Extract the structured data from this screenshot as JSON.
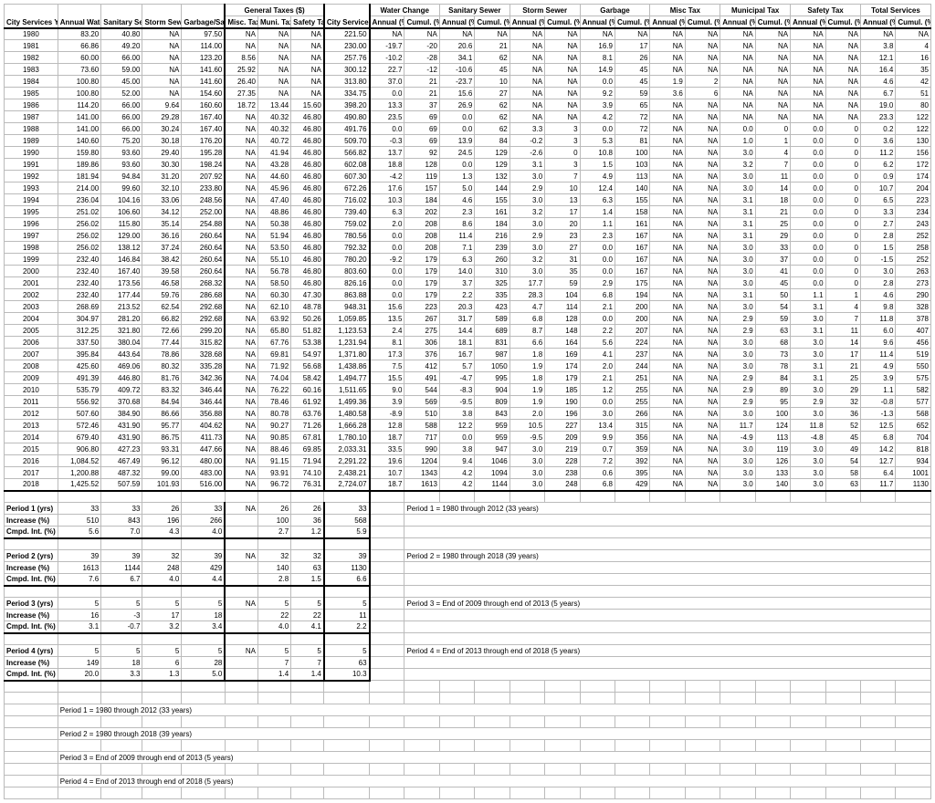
{
  "headers": {
    "top": [
      "City Services Year",
      "Annual Water Cost ($)",
      "Sanitary Sewer Cost ($)",
      "Storm Sewer Cost ($)",
      "Garbage/Sanitation Cost ($)",
      "General Taxes ($)",
      "",
      "",
      "City Services Total ($)",
      "Water Change",
      "",
      "Sanitary Sewer",
      "",
      "Storm Sewer",
      "",
      "Garbage",
      "",
      "Misc Tax",
      "",
      "Municipal Tax",
      "",
      "Safety Tax",
      "",
      "Total Services",
      ""
    ],
    "sub": [
      "",
      "",
      "",
      "",
      "",
      "Misc. Tax",
      "Muni. Tax",
      "Safety Tax",
      "",
      "Annual (%)",
      "Cumul. (%)",
      "Annual (%)",
      "Cumul. (%)",
      "Annual (%)",
      "Cumul. (%)",
      "Annual (%)",
      "Cumul. (%)",
      "Annual (%)",
      "Cumul. (%)",
      "Annual (%)",
      "Cumul. (%)",
      "Annual (%)",
      "Cumul. (%)",
      "Annual (%)",
      "Cumul. (%)"
    ]
  },
  "rows": [
    [
      "1980",
      "83.20",
      "40.80",
      "NA",
      "97.50",
      "NA",
      "NA",
      "NA",
      "221.50",
      "NA",
      "NA",
      "NA",
      "NA",
      "NA",
      "NA",
      "NA",
      "NA",
      "NA",
      "NA",
      "NA",
      "NA",
      "NA",
      "NA",
      "NA",
      "NA"
    ],
    [
      "1981",
      "66.86",
      "49.20",
      "NA",
      "114.00",
      "NA",
      "NA",
      "NA",
      "230.00",
      "-19.7",
      "-20",
      "20.6",
      "21",
      "NA",
      "NA",
      "16.9",
      "17",
      "NA",
      "NA",
      "NA",
      "NA",
      "NA",
      "NA",
      "3.8",
      "4"
    ],
    [
      "1982",
      "60.00",
      "66.00",
      "NA",
      "123.20",
      "8.56",
      "NA",
      "NA",
      "257.76",
      "-10.2",
      "-28",
      "34.1",
      "62",
      "NA",
      "NA",
      "8.1",
      "26",
      "NA",
      "NA",
      "NA",
      "NA",
      "NA",
      "NA",
      "12.1",
      "16"
    ],
    [
      "1983",
      "73.60",
      "59.00",
      "NA",
      "141.60",
      "25.92",
      "NA",
      "NA",
      "300.12",
      "22.7",
      "-12",
      "-10.6",
      "45",
      "NA",
      "NA",
      "14.9",
      "45",
      "NA",
      "NA",
      "NA",
      "NA",
      "NA",
      "NA",
      "16.4",
      "35"
    ],
    [
      "1984",
      "100.80",
      "45.00",
      "NA",
      "141.60",
      "26.40",
      "NA",
      "NA",
      "313.80",
      "37.0",
      "21",
      "-23.7",
      "10",
      "NA",
      "NA",
      "0.0",
      "45",
      "1.9",
      "2",
      "NA",
      "NA",
      "NA",
      "NA",
      "4.6",
      "42"
    ],
    [
      "1985",
      "100.80",
      "52.00",
      "NA",
      "154.60",
      "27.35",
      "NA",
      "NA",
      "334.75",
      "0.0",
      "21",
      "15.6",
      "27",
      "NA",
      "NA",
      "9.2",
      "59",
      "3.6",
      "6",
      "NA",
      "NA",
      "NA",
      "NA",
      "6.7",
      "51"
    ],
    [
      "1986",
      "114.20",
      "66.00",
      "9.64",
      "160.60",
      "18.72",
      "13.44",
      "15.60",
      "398.20",
      "13.3",
      "37",
      "26.9",
      "62",
      "NA",
      "NA",
      "3.9",
      "65",
      "NA",
      "NA",
      "NA",
      "NA",
      "NA",
      "NA",
      "19.0",
      "80"
    ],
    [
      "1987",
      "141.00",
      "66.00",
      "29.28",
      "167.40",
      "NA",
      "40.32",
      "46.80",
      "490.80",
      "23.5",
      "69",
      "0.0",
      "62",
      "NA",
      "NA",
      "4.2",
      "72",
      "NA",
      "NA",
      "NA",
      "NA",
      "NA",
      "NA",
      "23.3",
      "122"
    ],
    [
      "1988",
      "141.00",
      "66.00",
      "30.24",
      "167.40",
      "NA",
      "40.32",
      "46.80",
      "491.76",
      "0.0",
      "69",
      "0.0",
      "62",
      "3.3",
      "3",
      "0.0",
      "72",
      "NA",
      "NA",
      "0.0",
      "0",
      "0.0",
      "0",
      "0.2",
      "122"
    ],
    [
      "1989",
      "140.60",
      "75.20",
      "30.18",
      "176.20",
      "NA",
      "40.72",
      "46.80",
      "509.70",
      "-0.3",
      "69",
      "13.9",
      "84",
      "-0.2",
      "3",
      "5.3",
      "81",
      "NA",
      "NA",
      "1.0",
      "1",
      "0.0",
      "0",
      "3.6",
      "130"
    ],
    [
      "1990",
      "159.80",
      "93.60",
      "29.40",
      "195.28",
      "NA",
      "41.94",
      "46.80",
      "566.82",
      "13.7",
      "92",
      "24.5",
      "129",
      "-2.6",
      "0",
      "10.8",
      "100",
      "NA",
      "NA",
      "3.0",
      "4",
      "0.0",
      "0",
      "11.2",
      "156"
    ],
    [
      "1991",
      "189.86",
      "93.60",
      "30.30",
      "198.24",
      "NA",
      "43.28",
      "46.80",
      "602.08",
      "18.8",
      "128",
      "0.0",
      "129",
      "3.1",
      "3",
      "1.5",
      "103",
      "NA",
      "NA",
      "3.2",
      "7",
      "0.0",
      "0",
      "6.2",
      "172"
    ],
    [
      "1992",
      "181.94",
      "94.84",
      "31.20",
      "207.92",
      "NA",
      "44.60",
      "46.80",
      "607.30",
      "-4.2",
      "119",
      "1.3",
      "132",
      "3.0",
      "7",
      "4.9",
      "113",
      "NA",
      "NA",
      "3.0",
      "11",
      "0.0",
      "0",
      "0.9",
      "174"
    ],
    [
      "1993",
      "214.00",
      "99.60",
      "32.10",
      "233.80",
      "NA",
      "45.96",
      "46.80",
      "672.26",
      "17.6",
      "157",
      "5.0",
      "144",
      "2.9",
      "10",
      "12.4",
      "140",
      "NA",
      "NA",
      "3.0",
      "14",
      "0.0",
      "0",
      "10.7",
      "204"
    ],
    [
      "1994",
      "236.04",
      "104.16",
      "33.06",
      "248.56",
      "NA",
      "47.40",
      "46.80",
      "716.02",
      "10.3",
      "184",
      "4.6",
      "155",
      "3.0",
      "13",
      "6.3",
      "155",
      "NA",
      "NA",
      "3.1",
      "18",
      "0.0",
      "0",
      "6.5",
      "223"
    ],
    [
      "1995",
      "251.02",
      "106.60",
      "34.12",
      "252.00",
      "NA",
      "48.86",
      "46.80",
      "739.40",
      "6.3",
      "202",
      "2.3",
      "161",
      "3.2",
      "17",
      "1.4",
      "158",
      "NA",
      "NA",
      "3.1",
      "21",
      "0.0",
      "0",
      "3.3",
      "234"
    ],
    [
      "1996",
      "256.02",
      "115.80",
      "35.14",
      "254.88",
      "NA",
      "50.38",
      "46.80",
      "759.02",
      "2.0",
      "208",
      "8.6",
      "184",
      "3.0",
      "20",
      "1.1",
      "161",
      "NA",
      "NA",
      "3.1",
      "25",
      "0.0",
      "0",
      "2.7",
      "243"
    ],
    [
      "1997",
      "256.02",
      "129.00",
      "36.16",
      "260.64",
      "NA",
      "51.94",
      "46.80",
      "780.56",
      "0.0",
      "208",
      "11.4",
      "216",
      "2.9",
      "23",
      "2.3",
      "167",
      "NA",
      "NA",
      "3.1",
      "29",
      "0.0",
      "0",
      "2.8",
      "252"
    ],
    [
      "1998",
      "256.02",
      "138.12",
      "37.24",
      "260.64",
      "NA",
      "53.50",
      "46.80",
      "792.32",
      "0.0",
      "208",
      "7.1",
      "239",
      "3.0",
      "27",
      "0.0",
      "167",
      "NA",
      "NA",
      "3.0",
      "33",
      "0.0",
      "0",
      "1.5",
      "258"
    ],
    [
      "1999",
      "232.40",
      "146.84",
      "38.42",
      "260.64",
      "NA",
      "55.10",
      "46.80",
      "780.20",
      "-9.2",
      "179",
      "6.3",
      "260",
      "3.2",
      "31",
      "0.0",
      "167",
      "NA",
      "NA",
      "3.0",
      "37",
      "0.0",
      "0",
      "-1.5",
      "252"
    ],
    [
      "2000",
      "232.40",
      "167.40",
      "39.58",
      "260.64",
      "NA",
      "56.78",
      "46.80",
      "803.60",
      "0.0",
      "179",
      "14.0",
      "310",
      "3.0",
      "35",
      "0.0",
      "167",
      "NA",
      "NA",
      "3.0",
      "41",
      "0.0",
      "0",
      "3.0",
      "263"
    ],
    [
      "2001",
      "232.40",
      "173.56",
      "46.58",
      "268.32",
      "NA",
      "58.50",
      "46.80",
      "826.16",
      "0.0",
      "179",
      "3.7",
      "325",
      "17.7",
      "59",
      "2.9",
      "175",
      "NA",
      "NA",
      "3.0",
      "45",
      "0.0",
      "0",
      "2.8",
      "273"
    ],
    [
      "2002",
      "232.40",
      "177.44",
      "59.76",
      "286.68",
      "NA",
      "60.30",
      "47.30",
      "863.88",
      "0.0",
      "179",
      "2.2",
      "335",
      "28.3",
      "104",
      "6.8",
      "194",
      "NA",
      "NA",
      "3.1",
      "50",
      "1.1",
      "1",
      "4.6",
      "290"
    ],
    [
      "2003",
      "268.69",
      "213.52",
      "62.54",
      "292.68",
      "NA",
      "62.10",
      "48.78",
      "948.31",
      "15.6",
      "223",
      "20.3",
      "423",
      "4.7",
      "114",
      "2.1",
      "200",
      "NA",
      "NA",
      "3.0",
      "54",
      "3.1",
      "4",
      "9.8",
      "328"
    ],
    [
      "2004",
      "304.97",
      "281.20",
      "66.82",
      "292.68",
      "NA",
      "63.92",
      "50.26",
      "1,059.85",
      "13.5",
      "267",
      "31.7",
      "589",
      "6.8",
      "128",
      "0.0",
      "200",
      "NA",
      "NA",
      "2.9",
      "59",
      "3.0",
      "7",
      "11.8",
      "378"
    ],
    [
      "2005",
      "312.25",
      "321.80",
      "72.66",
      "299.20",
      "NA",
      "65.80",
      "51.82",
      "1,123.53",
      "2.4",
      "275",
      "14.4",
      "689",
      "8.7",
      "148",
      "2.2",
      "207",
      "NA",
      "NA",
      "2.9",
      "63",
      "3.1",
      "11",
      "6.0",
      "407"
    ],
    [
      "2006",
      "337.50",
      "380.04",
      "77.44",
      "315.82",
      "NA",
      "67.76",
      "53.38",
      "1,231.94",
      "8.1",
      "306",
      "18.1",
      "831",
      "6.6",
      "164",
      "5.6",
      "224",
      "NA",
      "NA",
      "3.0",
      "68",
      "3.0",
      "14",
      "9.6",
      "456"
    ],
    [
      "2007",
      "395.84",
      "443.64",
      "78.86",
      "328.68",
      "NA",
      "69.81",
      "54.97",
      "1,371.80",
      "17.3",
      "376",
      "16.7",
      "987",
      "1.8",
      "169",
      "4.1",
      "237",
      "NA",
      "NA",
      "3.0",
      "73",
      "3.0",
      "17",
      "11.4",
      "519"
    ],
    [
      "2008",
      "425.60",
      "469.06",
      "80.32",
      "335.28",
      "NA",
      "71.92",
      "56.68",
      "1,438.86",
      "7.5",
      "412",
      "5.7",
      "1050",
      "1.9",
      "174",
      "2.0",
      "244",
      "NA",
      "NA",
      "3.0",
      "78",
      "3.1",
      "21",
      "4.9",
      "550"
    ],
    [
      "2009",
      "491.39",
      "446.80",
      "81.76",
      "342.36",
      "NA",
      "74.04",
      "58.42",
      "1,494.77",
      "15.5",
      "491",
      "-4.7",
      "995",
      "1.8",
      "179",
      "2.1",
      "251",
      "NA",
      "NA",
      "2.9",
      "84",
      "3.1",
      "25",
      "3.9",
      "575"
    ],
    [
      "2010",
      "535.79",
      "409.72",
      "83.32",
      "346.44",
      "NA",
      "76.22",
      "60.16",
      "1,511.65",
      "9.0",
      "544",
      "-8.3",
      "904",
      "1.9",
      "185",
      "1.2",
      "255",
      "NA",
      "NA",
      "2.9",
      "89",
      "3.0",
      "29",
      "1.1",
      "582"
    ],
    [
      "2011",
      "556.92",
      "370.68",
      "84.94",
      "346.44",
      "NA",
      "78.46",
      "61.92",
      "1,499.36",
      "3.9",
      "569",
      "-9.5",
      "809",
      "1.9",
      "190",
      "0.0",
      "255",
      "NA",
      "NA",
      "2.9",
      "95",
      "2.9",
      "32",
      "-0.8",
      "577"
    ],
    [
      "2012",
      "507.60",
      "384.90",
      "86.66",
      "356.88",
      "NA",
      "80.78",
      "63.76",
      "1,480.58",
      "-8.9",
      "510",
      "3.8",
      "843",
      "2.0",
      "196",
      "3.0",
      "266",
      "NA",
      "NA",
      "3.0",
      "100",
      "3.0",
      "36",
      "-1.3",
      "568"
    ],
    [
      "2013",
      "572.46",
      "431.90",
      "95.77",
      "404.62",
      "NA",
      "90.27",
      "71.26",
      "1,666.28",
      "12.8",
      "588",
      "12.2",
      "959",
      "10.5",
      "227",
      "13.4",
      "315",
      "NA",
      "NA",
      "11.7",
      "124",
      "11.8",
      "52",
      "12.5",
      "652"
    ],
    [
      "2014",
      "679.40",
      "431.90",
      "86.75",
      "411.73",
      "NA",
      "90.85",
      "67.81",
      "1,780.10",
      "18.7",
      "717",
      "0.0",
      "959",
      "-9.5",
      "209",
      "9.9",
      "356",
      "NA",
      "NA",
      "-4.9",
      "113",
      "-4.8",
      "45",
      "6.8",
      "704"
    ],
    [
      "2015",
      "906.80",
      "427.23",
      "93.31",
      "447.66",
      "NA",
      "88.46",
      "69.85",
      "2,033.31",
      "33.5",
      "990",
      "3.8",
      "947",
      "3.0",
      "219",
      "0.7",
      "359",
      "NA",
      "NA",
      "3.0",
      "119",
      "3.0",
      "49",
      "14.2",
      "818"
    ],
    [
      "2016",
      "1,084.52",
      "467.49",
      "96.12",
      "480.00",
      "NA",
      "91.15",
      "71.94",
      "2,291.22",
      "19.6",
      "1204",
      "9.4",
      "1046",
      "3.0",
      "228",
      "7.2",
      "392",
      "NA",
      "NA",
      "3.0",
      "126",
      "3.0",
      "54",
      "12.7",
      "934"
    ],
    [
      "2017",
      "1,200.88",
      "487.32",
      "99.00",
      "483.00",
      "NA",
      "93.91",
      "74.10",
      "2,438.21",
      "10.7",
      "1343",
      "4.2",
      "1094",
      "3.0",
      "238",
      "0.6",
      "395",
      "NA",
      "NA",
      "3.0",
      "133",
      "3.0",
      "58",
      "6.4",
      "1001"
    ],
    [
      "2018",
      "1,425.52",
      "507.59",
      "101.93",
      "516.00",
      "NA",
      "96.72",
      "76.31",
      "2,724.07",
      "18.7",
      "1613",
      "4.2",
      "1144",
      "3.0",
      "248",
      "6.8",
      "429",
      "NA",
      "NA",
      "3.0",
      "140",
      "3.0",
      "63",
      "11.7",
      "1130"
    ]
  ],
  "periods": [
    {
      "label": "Period 1 (yrs)",
      "vals": [
        "33",
        "33",
        "26",
        "33",
        "NA",
        "26",
        "26",
        "33"
      ],
      "desc": "Period 1 = 1980 through 2012 (33 years)"
    },
    {
      "label": "Increase (%)",
      "vals": [
        "510",
        "843",
        "196",
        "266",
        "",
        "100",
        "36",
        "568"
      ],
      "desc": ""
    },
    {
      "label": "Cmpd. Int. (%)",
      "vals": [
        "5.6",
        "7.0",
        "4.3",
        "4.0",
        "",
        "2.7",
        "1.2",
        "5.9"
      ],
      "desc": ""
    },
    {
      "label": "",
      "vals": [
        "",
        "",
        "",
        "",
        "",
        "",
        "",
        ""
      ],
      "desc": ""
    },
    {
      "label": "Period 2 (yrs)",
      "vals": [
        "39",
        "39",
        "32",
        "39",
        "NA",
        "32",
        "32",
        "39"
      ],
      "desc": "Period 2 = 1980 through 2018 (39 years)"
    },
    {
      "label": "Increase (%)",
      "vals": [
        "1613",
        "1144",
        "248",
        "429",
        "",
        "140",
        "63",
        "1130"
      ],
      "desc": ""
    },
    {
      "label": "Cmpd. Int. (%)",
      "vals": [
        "7.6",
        "6.7",
        "4.0",
        "4.4",
        "",
        "2.8",
        "1.5",
        "6.6"
      ],
      "desc": ""
    },
    {
      "label": "",
      "vals": [
        "",
        "",
        "",
        "",
        "",
        "",
        "",
        ""
      ],
      "desc": ""
    },
    {
      "label": "Period 3 (yrs)",
      "vals": [
        "5",
        "5",
        "5",
        "5",
        "NA",
        "5",
        "5",
        "5"
      ],
      "desc": "Period 3 = End of 2009 through end of 2013 (5 years)"
    },
    {
      "label": "Increase (%)",
      "vals": [
        "16",
        "-3",
        "17",
        "18",
        "",
        "22",
        "22",
        "11"
      ],
      "desc": ""
    },
    {
      "label": "Cmpd. Int. (%)",
      "vals": [
        "3.1",
        "-0.7",
        "3.2",
        "3.4",
        "",
        "4.0",
        "4.1",
        "2.2"
      ],
      "desc": ""
    },
    {
      "label": "",
      "vals": [
        "",
        "",
        "",
        "",
        "",
        "",
        "",
        ""
      ],
      "desc": ""
    },
    {
      "label": "Period 4 (yrs)",
      "vals": [
        "5",
        "5",
        "5",
        "5",
        "NA",
        "5",
        "5",
        "5"
      ],
      "desc": "Period 4 = End of 2013 through end of 2018 (5 years)"
    },
    {
      "label": "Increase (%)",
      "vals": [
        "149",
        "18",
        "6",
        "28",
        "",
        "7",
        "7",
        "63"
      ],
      "desc": ""
    },
    {
      "label": "Cmpd. Int. (%)",
      "vals": [
        "20.0",
        "3.3",
        "1.3",
        "5.0",
        "",
        "1.4",
        "1.4",
        "10.3"
      ],
      "desc": ""
    }
  ],
  "footnotes": [
    "Period 1 = 1980 through 2012 (33 years)",
    "Period 2 = 1980 through 2018 (39 years)",
    "Period 3 = End of 2009 through end of 2013 (5 years)",
    "Period 4 = End of 2013 through end of 2018 (5 years)"
  ]
}
